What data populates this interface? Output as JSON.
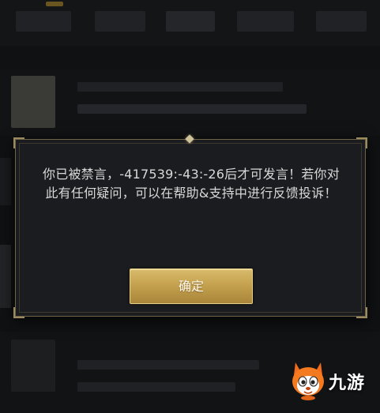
{
  "dialog": {
    "message": "你已被禁言，-417539:-43:-26后才可发言！若你对此有任何疑问，可以在帮助&支持中进行反馈投诉！",
    "confirm_label": "确定"
  },
  "watermark": {
    "brand_text": "九游"
  },
  "colors": {
    "dialog_background": "#1b1c1f",
    "dialog_border": "#6e6547",
    "button_gold": "#c5a24f",
    "message_text": "#d9d9d9"
  },
  "icons": {
    "watermark_logo": "fox-mascot-icon",
    "top_ornament": "diamond-ornament-icon"
  }
}
